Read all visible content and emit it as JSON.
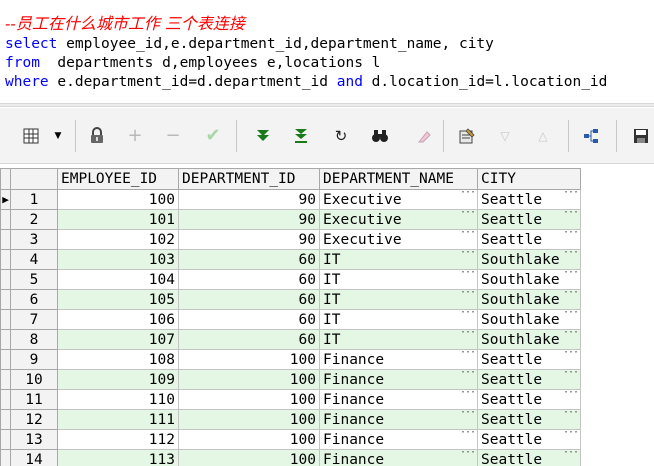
{
  "editor": {
    "comment": "--员工在什么城市工作 三个表连接",
    "line2_kw": "select",
    "line2_rest": " employee_id,e.department_id,department_name, city",
    "line3_kw": "from",
    "line3_rest": "  departments d,employees e,locations l",
    "line4_kw1": "where",
    "line4_mid": " e.department_id=d.department_id ",
    "line4_kw2": "and",
    "line4_rest": " d.location_id=l.location_id"
  },
  "toolbar": {
    "icons": [
      "grid-icon",
      "dropdown-arrow-icon",
      "lock-icon",
      "plus-icon",
      "minus-icon",
      "check-icon",
      "fetch-next-icon",
      "fetch-last-icon",
      "refresh-icon",
      "find-icon",
      "clear-icon",
      "edit-record-icon",
      "sort-down-icon",
      "sort-up-icon",
      "query-plan-icon",
      "save-icon"
    ]
  },
  "colors": {
    "row_alt": "#e4f7e4",
    "comment": "#ff0000",
    "keyword": "#0000ff"
  },
  "grid": {
    "columns": [
      "EMPLOYEE_ID",
      "DEPARTMENT_ID",
      "DEPARTMENT_NAME",
      "CITY"
    ],
    "current_row_marker": "▶",
    "rows": [
      {
        "n": "1",
        "emp": "100",
        "dept": "90",
        "name": "Executive",
        "city": "Seattle"
      },
      {
        "n": "2",
        "emp": "101",
        "dept": "90",
        "name": "Executive",
        "city": "Seattle"
      },
      {
        "n": "3",
        "emp": "102",
        "dept": "90",
        "name": "Executive",
        "city": "Seattle"
      },
      {
        "n": "4",
        "emp": "103",
        "dept": "60",
        "name": "IT",
        "city": "Southlake"
      },
      {
        "n": "5",
        "emp": "104",
        "dept": "60",
        "name": "IT",
        "city": "Southlake"
      },
      {
        "n": "6",
        "emp": "105",
        "dept": "60",
        "name": "IT",
        "city": "Southlake"
      },
      {
        "n": "7",
        "emp": "106",
        "dept": "60",
        "name": "IT",
        "city": "Southlake"
      },
      {
        "n": "8",
        "emp": "107",
        "dept": "60",
        "name": "IT",
        "city": "Southlake"
      },
      {
        "n": "9",
        "emp": "108",
        "dept": "100",
        "name": "Finance",
        "city": "Seattle"
      },
      {
        "n": "10",
        "emp": "109",
        "dept": "100",
        "name": "Finance",
        "city": "Seattle"
      },
      {
        "n": "11",
        "emp": "110",
        "dept": "100",
        "name": "Finance",
        "city": "Seattle"
      },
      {
        "n": "12",
        "emp": "111",
        "dept": "100",
        "name": "Finance",
        "city": "Seattle"
      },
      {
        "n": "13",
        "emp": "112",
        "dept": "100",
        "name": "Finance",
        "city": "Seattle"
      },
      {
        "n": "14",
        "emp": "113",
        "dept": "100",
        "name": "Finance",
        "city": "Seattle"
      }
    ]
  }
}
